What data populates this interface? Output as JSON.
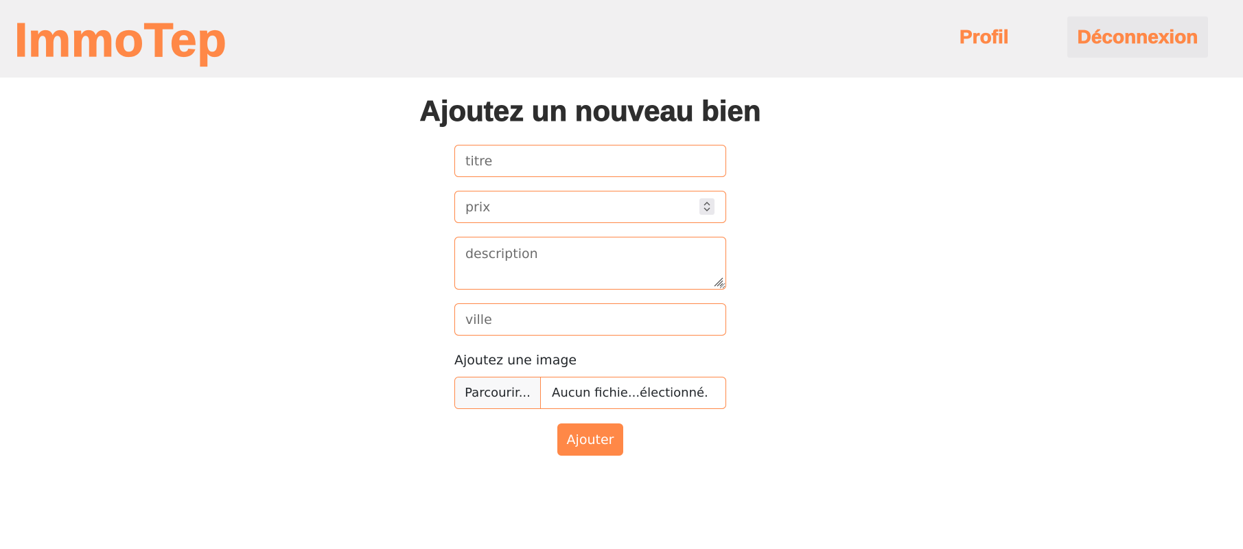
{
  "navbar": {
    "brand": "ImmoTep",
    "links": {
      "profil": "Profil",
      "logout": "Déconnexion"
    }
  },
  "page": {
    "title": "Ajoutez un nouveau bien"
  },
  "form": {
    "titre": {
      "placeholder": "titre",
      "value": ""
    },
    "prix": {
      "placeholder": "prix",
      "value": ""
    },
    "description": {
      "placeholder": "description",
      "value": ""
    },
    "ville": {
      "placeholder": "ville",
      "value": ""
    },
    "image_label": "Ajoutez une image",
    "file_button": "Parcourir...",
    "file_status": "Aucun fichie...électionné.",
    "submit": "Ajouter"
  },
  "colors": {
    "accent": "#ff8847",
    "navbar_bg": "#f1f0f1",
    "title_text": "#2e2e2e"
  },
  "icons": {
    "spinner": "up-down-chevron-icon",
    "resize": "resize-grip-icon"
  }
}
